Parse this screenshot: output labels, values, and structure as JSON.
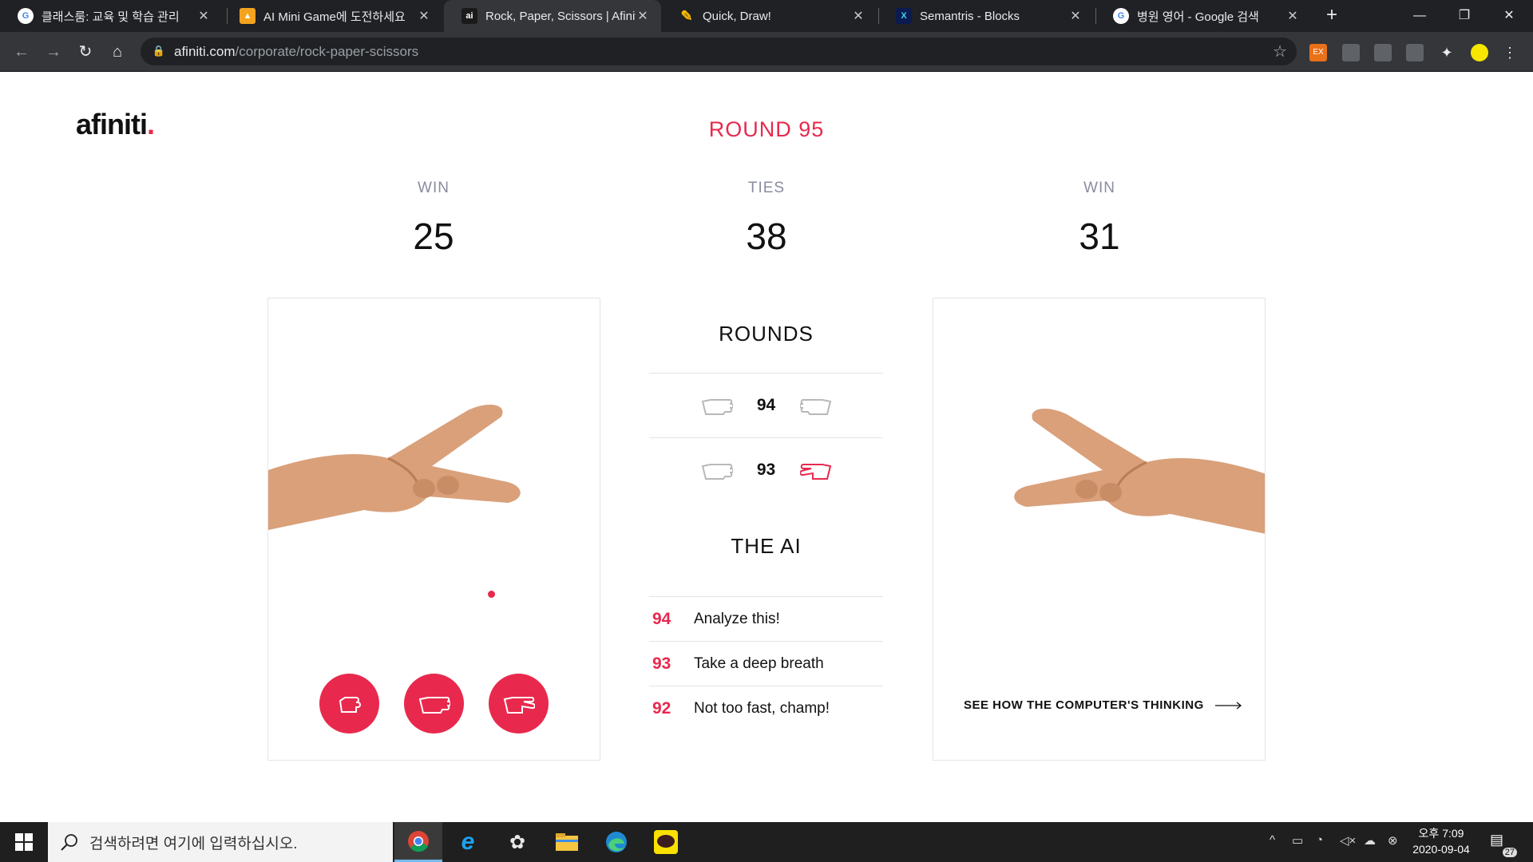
{
  "browser": {
    "tabs": [
      {
        "title": "클래스룸: 교육 및 학습 관리",
        "icon": "google-icon"
      },
      {
        "title": "AI Mini Game에 도전하세요",
        "icon": "slides-icon"
      },
      {
        "title": "Rock, Paper, Scissors | Afinit",
        "icon": "afiniti-icon"
      },
      {
        "title": "Quick, Draw!",
        "icon": "quickdraw-icon"
      },
      {
        "title": "Semantris - Blocks",
        "icon": "semantris-icon"
      },
      {
        "title": "병원 영어 - Google 검색",
        "icon": "google-icon"
      }
    ],
    "active_tab": 2,
    "url_domain": "afiniti.com",
    "url_path": "/corporate/rock-paper-scissors",
    "ext_badge": "EX"
  },
  "page": {
    "logo": "afiniti",
    "round_label": "ROUND 95",
    "scores": {
      "player": {
        "label": "WIN",
        "value": "25"
      },
      "ties": {
        "label": "TIES",
        "value": "38"
      },
      "computer": {
        "label": "WIN",
        "value": "31"
      }
    },
    "rounds_heading": "ROUNDS",
    "rounds": [
      {
        "number": "94"
      },
      {
        "number": "93"
      }
    ],
    "ai_heading": "THE AI",
    "ai_messages": [
      {
        "number": "94",
        "text": "Analyze this!"
      },
      {
        "number": "93",
        "text": "Take a deep breath"
      },
      {
        "number": "92",
        "text": "Not too fast, champ!"
      }
    ],
    "think_link": "SEE HOW THE COMPUTER'S THINKING",
    "accent_color": "#e8294d"
  },
  "taskbar": {
    "search_placeholder": "검색하려면 여기에 입력하십시오.",
    "time_period": "오후 7:09",
    "date": "2020-09-04",
    "notification_count": "27"
  }
}
